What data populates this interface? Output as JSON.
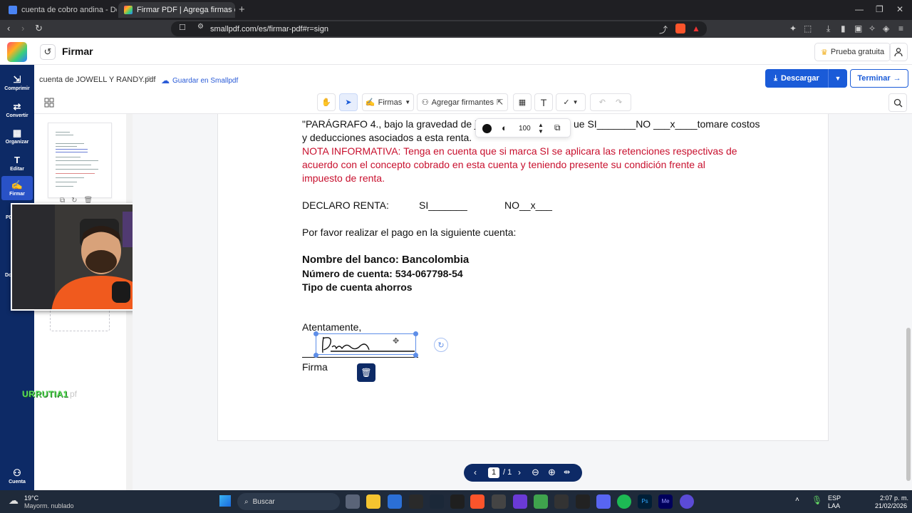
{
  "browser": {
    "tabs": [
      {
        "title": "cuenta de cobro andina - Document",
        "active": false
      },
      {
        "title": "Firmar PDF | Agrega firmas electr",
        "active": true
      }
    ],
    "url": "smallpdf.com/es/firmar-pdf#r=sign",
    "new_tab_label": "+"
  },
  "app": {
    "title": "Firmar",
    "trial_label": "Prueba gratuita",
    "nav": [
      {
        "label": "Comprimir",
        "icon": "compress-icon"
      },
      {
        "label": "Convertir",
        "icon": "convert-icon"
      },
      {
        "label": "Organizar",
        "icon": "organize-icon"
      },
      {
        "label": "Editar",
        "icon": "edit-icon"
      },
      {
        "label": "Firmar",
        "icon": "sign-icon"
      },
      {
        "label": "Cuenta",
        "icon": "account-icon"
      }
    ],
    "nav_partial": [
      "PD",
      "Do"
    ]
  },
  "file": {
    "name": "cuenta de JOWELL Y RANDY.pdf",
    "save_label": "Guardar en Smallpdf",
    "download_label": "Descargar",
    "finish_label": "Terminar"
  },
  "toolbar": {
    "signatures_label": "Firmas",
    "signers_label": "Agregar firmantes"
  },
  "popover": {
    "opacity_value": "100"
  },
  "document": {
    "para4_line1a": "\"PARÁGRAFO 4., bajo la gravedad de ju",
    "para4_line1b": "ue SI_______NO ___x____tomare costos",
    "para4_line2": "y deducciones asociados a esta renta.",
    "nota_line1": "NOTA INFORMATIVA: Tenga en cuenta que si marca SI se aplicara las retenciones respectivas de",
    "nota_line2": "acuerdo con el concepto cobrado en esta cuenta y teniendo presente su condición frente al",
    "nota_line3": "impuesto de renta.",
    "declaro_label": "DECLARO RENTA:",
    "declaro_si": "SI_______",
    "declaro_no": "NO__x___",
    "payment_line": "Por favor realizar el pago en la siguiente cuenta:",
    "bank_line": "Nombre del banco: Bancolombia",
    "account_line": "Número de cuenta: 534-067798-54",
    "type_line": "Tipo de cuenta ahorros",
    "closing": "Atentamente,",
    "sign_label": "Firma"
  },
  "pagination": {
    "current": "1",
    "total": "/ 1"
  },
  "overlay": {
    "brand": "URRUTIA1",
    "brand_suffix": "pf"
  },
  "taskbar": {
    "weather_temp": "19°C",
    "weather_desc": "Mayorm. nublado",
    "search_label": "Buscar",
    "lang1": "ESP",
    "lang2": "LAA",
    "time": "2:07 p. m.",
    "date": "21/02/2026"
  },
  "colors": {
    "nav_bg": "#0d2a66",
    "accent": "#1a5bd8",
    "note_red": "#c8102e"
  }
}
